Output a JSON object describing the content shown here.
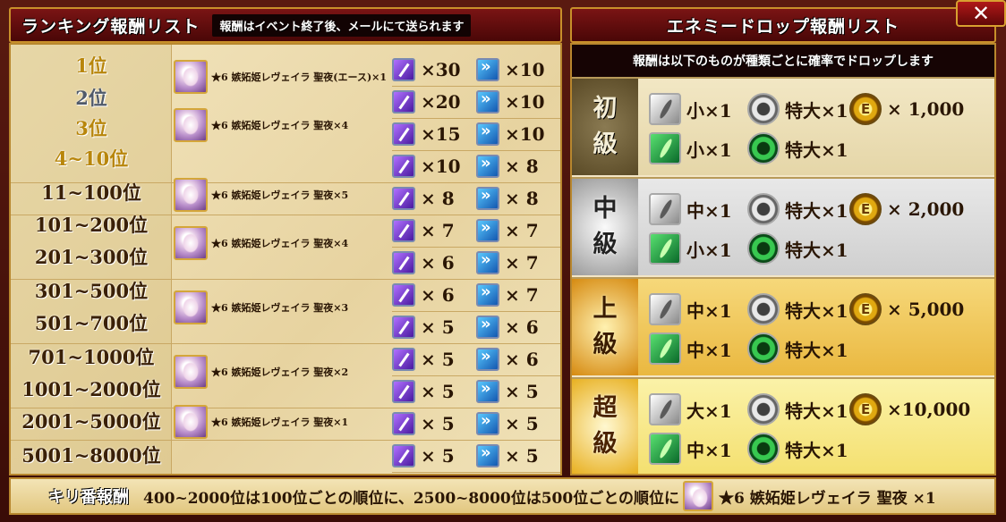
{
  "ranking": {
    "title": "ランキング報酬リスト",
    "subtitle": "報酬はイベント終了後、メールにて送られます",
    "rows": [
      {
        "rank": "1位",
        "style": "gold",
        "prize": "★6 嫉妬姫レヴェイラ 聖夜(エース)×1",
        "purple": "×30",
        "blue": "×10"
      },
      {
        "rank": "2位",
        "style": "silver",
        "prize": "★6 嫉妬姫レヴェイラ 聖夜×4",
        "purple": "×20",
        "blue": "×10"
      },
      {
        "rank": "3位",
        "style": "gold",
        "prize": "",
        "purple": "×15",
        "blue": "×10"
      },
      {
        "rank": "4~10位",
        "style": "gold",
        "prize": "",
        "purple": "×10",
        "blue": "× 8"
      },
      {
        "rank": "11~100位",
        "style": "plain",
        "prize": "★6 嫉妬姫レヴェイラ 聖夜×5",
        "purple": "× 8",
        "blue": "× 8"
      },
      {
        "rank": "101~200位",
        "style": "plain",
        "prize": "★6 嫉妬姫レヴェイラ 聖夜×4",
        "purple": "× 7",
        "blue": "× 7"
      },
      {
        "rank": "201~300位",
        "style": "plain",
        "prize": "",
        "purple": "× 6",
        "blue": "× 7"
      },
      {
        "rank": "301~500位",
        "style": "plain",
        "prize": "★6 嫉妬姫レヴェイラ 聖夜×3",
        "purple": "× 6",
        "blue": "× 7"
      },
      {
        "rank": "501~700位",
        "style": "plain",
        "prize": "",
        "purple": "× 5",
        "blue": "× 6"
      },
      {
        "rank": "701~1000位",
        "style": "plain",
        "prize": "★6 嫉妬姫レヴェイラ 聖夜×2",
        "purple": "× 5",
        "blue": "× 6"
      },
      {
        "rank": "1001~2000位",
        "style": "plain",
        "prize": "",
        "purple": "× 5",
        "blue": "× 5"
      },
      {
        "rank": "2001~5000位",
        "style": "plain",
        "prize": "★6 嫉妬姫レヴェイラ 聖夜×1",
        "purple": "× 5",
        "blue": "× 5"
      },
      {
        "rank": "5001~8000位",
        "style": "plain",
        "prize": "",
        "purple": "× 5",
        "blue": "× 5"
      }
    ]
  },
  "enemy_drop": {
    "title": "エネミードロップ報酬リスト",
    "subtitle": "報酬は以下のものが種類ごとに確率でドロップします",
    "tiers": [
      {
        "label1": "初",
        "label2": "級",
        "stone1": "小×1",
        "pearl": "特大×1",
        "coin": "× 1,000",
        "stone2": "小×1",
        "emerald": "特大×1"
      },
      {
        "label1": "中",
        "label2": "級",
        "stone1": "中×1",
        "pearl": "特大×1",
        "coin": "× 2,000",
        "stone2": "小×1",
        "emerald": "特大×1"
      },
      {
        "label1": "上",
        "label2": "級",
        "stone1": "中×1",
        "pearl": "特大×1",
        "coin": "× 5,000",
        "stone2": "中×1",
        "emerald": "特大×1"
      },
      {
        "label1": "超",
        "label2": "級",
        "stone1": "大×1",
        "pearl": "特大×1",
        "coin": "×10,000",
        "stone2": "中×1",
        "emerald": "特大×1"
      }
    ]
  },
  "bottom": {
    "title": "キリ番報酬",
    "text": "400~2000位は100位ごとの順位に、2500~8000位は500位ごとの順位に",
    "prize": "★6 嫉妬姫レヴェイラ 聖夜 ×1"
  },
  "icons": {
    "close": "close-icon",
    "ticket_purple": "purple-quill-ticket-icon",
    "ticket_blue": "blue-arrow-ticket-icon",
    "stone_silver": "silver-feather-stone-icon",
    "stone_green": "green-feather-stone-icon",
    "pearl": "pearl-ring-icon",
    "emerald": "emerald-ring-icon",
    "coin": "gold-coin-icon",
    "portrait": "character-portrait-icon"
  },
  "colors": {
    "header_red": "#7a1414",
    "border_gold": "#c8902a",
    "parchment": "#f3e6c0"
  }
}
